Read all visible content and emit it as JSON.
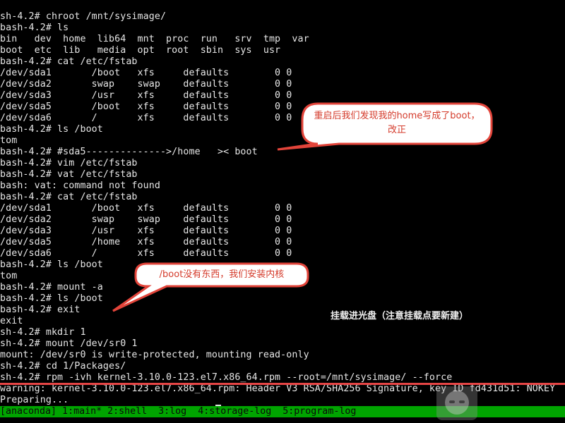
{
  "terminal": {
    "lines": [
      "sh-4.2# chroot /mnt/sysimage/",
      "bash-4.2# ls",
      "bin   dev  home  lib64  mnt  proc  run   srv  tmp  var",
      "boot  etc  lib   media  opt  root  sbin  sys  usr",
      "bash-4.2# cat /etc/fstab",
      "/dev/sda1       /boot   xfs     defaults        0 0",
      "/dev/sda2       swap    swap    defaults        0 0",
      "/dev/sda3       /usr    xfs     defaults        0 0",
      "/dev/sda5       /boot   xfs     defaults        0 0",
      "/dev/sda6       /       xfs     defaults        0 0",
      "bash-4.2# ls /boot",
      "tom",
      "bash-4.2# #sda5-------------->/home   >< boot",
      "bash-4.2# vim /etc/fstab",
      "bash-4.2# vat /etc/fstab",
      "bash: vat: command not found",
      "bash-4.2# cat /etc/fstab",
      "/dev/sda1       /boot   xfs     defaults        0 0",
      "/dev/sda2       swap    swap    defaults        0 0",
      "/dev/sda3       /usr    xfs     defaults        0 0",
      "/dev/sda5       /home   xfs     defaults        0 0",
      "/dev/sda6       /       xfs     defaults        0 0",
      "bash-4.2# ls /boot",
      "tom",
      "bash-4.2# mount -a",
      "bash-4.2# ls /boot",
      "bash-4.2# exit",
      "exit",
      "sh-4.2# mkdir 1",
      "sh-4.2# mount /dev/sr0 1",
      "mount: /dev/sr0 is write-protected, mounting read-only",
      "sh-4.2# cd 1/Packages/",
      "sh-4.2# rpm -ivh kernel-3.10.0-123.el7.x86_64.rpm --root=/mnt/sysimage/ --force",
      "warning: kernel-3.10.0-123.el7.x86_64.rpm: Header V3 RSA/SHA256 Signature, key ID fd431d51: NOKEY",
      "Preparing..."
    ]
  },
  "statusbar": {
    "text": "[anaconda] 1:main* 2:shell  3:log  4:storage-log  5:program-log"
  },
  "annotations": {
    "callout1": "重启后我们发现我的home写成了boot，改正",
    "callout2": "/boot没有东西，我们安装内核",
    "note": "挂载进光盘（注意挂载点要新建）"
  },
  "colors": {
    "background": "#000000",
    "text": "#e6e6e6",
    "statusbar": "#00a400",
    "callout_text": "#d43a2a",
    "divider": "#e64545"
  }
}
